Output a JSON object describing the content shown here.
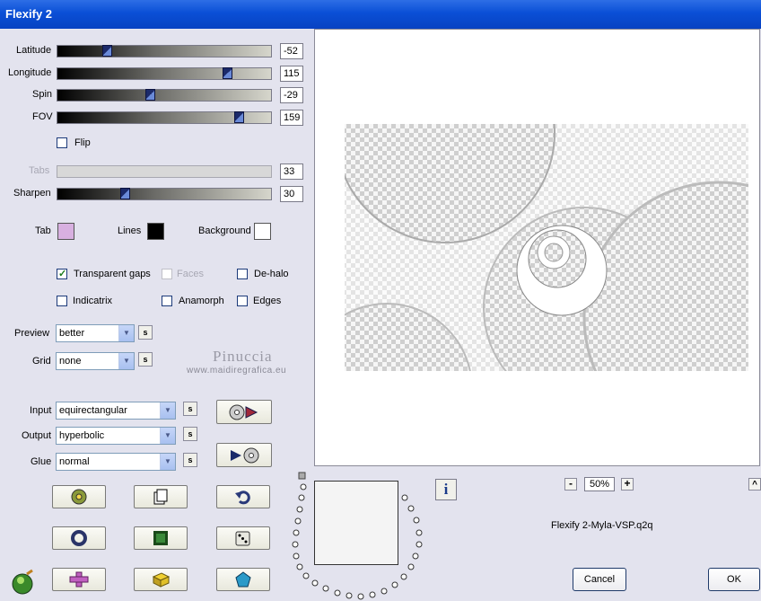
{
  "window": {
    "title": "Flexify 2"
  },
  "sliders": [
    {
      "label": "Latitude",
      "value": "-52",
      "fraction": 0.22
    },
    {
      "label": "Longitude",
      "value": "115",
      "fraction": 0.81
    },
    {
      "label": "Spin",
      "value": "-29",
      "fraction": 0.43
    },
    {
      "label": "FOV",
      "value": "159",
      "fraction": 0.87
    }
  ],
  "flip": {
    "label": "Flip",
    "checked": false
  },
  "tabs_slider": {
    "label": "Tabs",
    "value": "33"
  },
  "sharpen_slider": {
    "label": "Sharpen",
    "value": "30",
    "fraction": 0.31
  },
  "colors": {
    "tab_label": "Tab",
    "tab_color": "#d8b0e0",
    "lines_label": "Lines",
    "lines_color": "#000000",
    "background_label": "Background",
    "background_color": "#ffffff"
  },
  "options": {
    "transparent_gaps": "Transparent gaps",
    "faces": "Faces",
    "dehalo": "De-halo",
    "indicatrix": "Indicatrix",
    "anamorph": "Anamorph",
    "edges": "Edges"
  },
  "preview_select": {
    "label": "Preview",
    "value": "better"
  },
  "grid_select": {
    "label": "Grid",
    "value": "none"
  },
  "s_label": "s",
  "watermark": {
    "name": "Pinuccia",
    "url": "www.maidiregrafica.eu"
  },
  "input_select": {
    "label": "Input",
    "value": "equirectangular"
  },
  "output_select": {
    "label": "Output",
    "value": "hyperbolic"
  },
  "glue_select": {
    "label": "Glue",
    "value": "normal"
  },
  "zoom": {
    "value": "50%",
    "minus": "-",
    "plus": "+"
  },
  "preset_file": "Flexify 2-Myla-VSP.q2q",
  "buttons": {
    "cancel": "Cancel",
    "ok": "OK",
    "info": "i",
    "up": "^"
  },
  "icons": {
    "input_to_output": "disc-arrow-icon",
    "output_to_input": "arrow-disc-icon",
    "gear": "gear-icon",
    "copy": "copy-icon",
    "undo": "undo-icon",
    "ring": "ring-icon",
    "frame": "frame-icon",
    "dice": "dice-icon",
    "logo": "logo-icon",
    "cross": "cross-icon",
    "cube": "cube-icon",
    "gem": "gem-icon"
  }
}
